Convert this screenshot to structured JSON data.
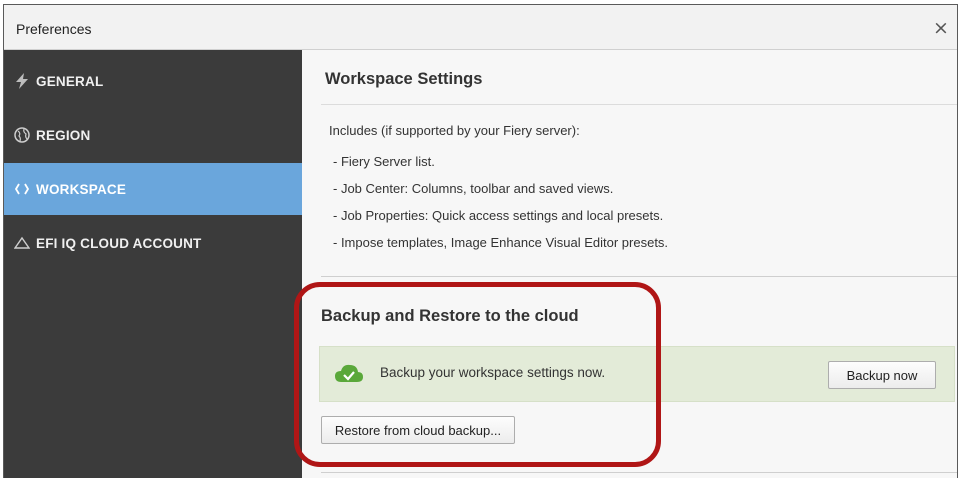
{
  "window": {
    "title": "Preferences",
    "close_glyph": "×"
  },
  "sidebar": {
    "items": [
      {
        "label": "GENERAL",
        "icon": "lightning-icon",
        "active": false
      },
      {
        "label": "REGION",
        "icon": "globe-icon",
        "active": false
      },
      {
        "label": "WORKSPACE",
        "icon": "sync-arrows-icon",
        "active": true
      },
      {
        "label": "EFI IQ CLOUD ACCOUNT",
        "icon": "cloud-outline-icon",
        "active": false
      }
    ]
  },
  "main": {
    "title": "Workspace Settings",
    "includes_heading": "Includes (if supported by your Fiery server):",
    "includes": [
      "- Fiery Server list.",
      "- Job Center: Columns, toolbar and saved views.",
      "- Job Properties: Quick access settings and local presets.",
      "- Impose templates, Image Enhance Visual Editor presets."
    ],
    "backup_section": {
      "title": "Backup and Restore to the cloud",
      "status_text": "Backup your workspace settings now.",
      "backup_button": "Backup now",
      "restore_button": "Restore from cloud backup..."
    }
  },
  "colors": {
    "sidebar_bg": "#3b3b3b",
    "active_item": "#6aa6dc",
    "backup_box": "#e3ebd8",
    "cloud_icon": "#5aa83a",
    "highlight_outline": "#b01616"
  }
}
